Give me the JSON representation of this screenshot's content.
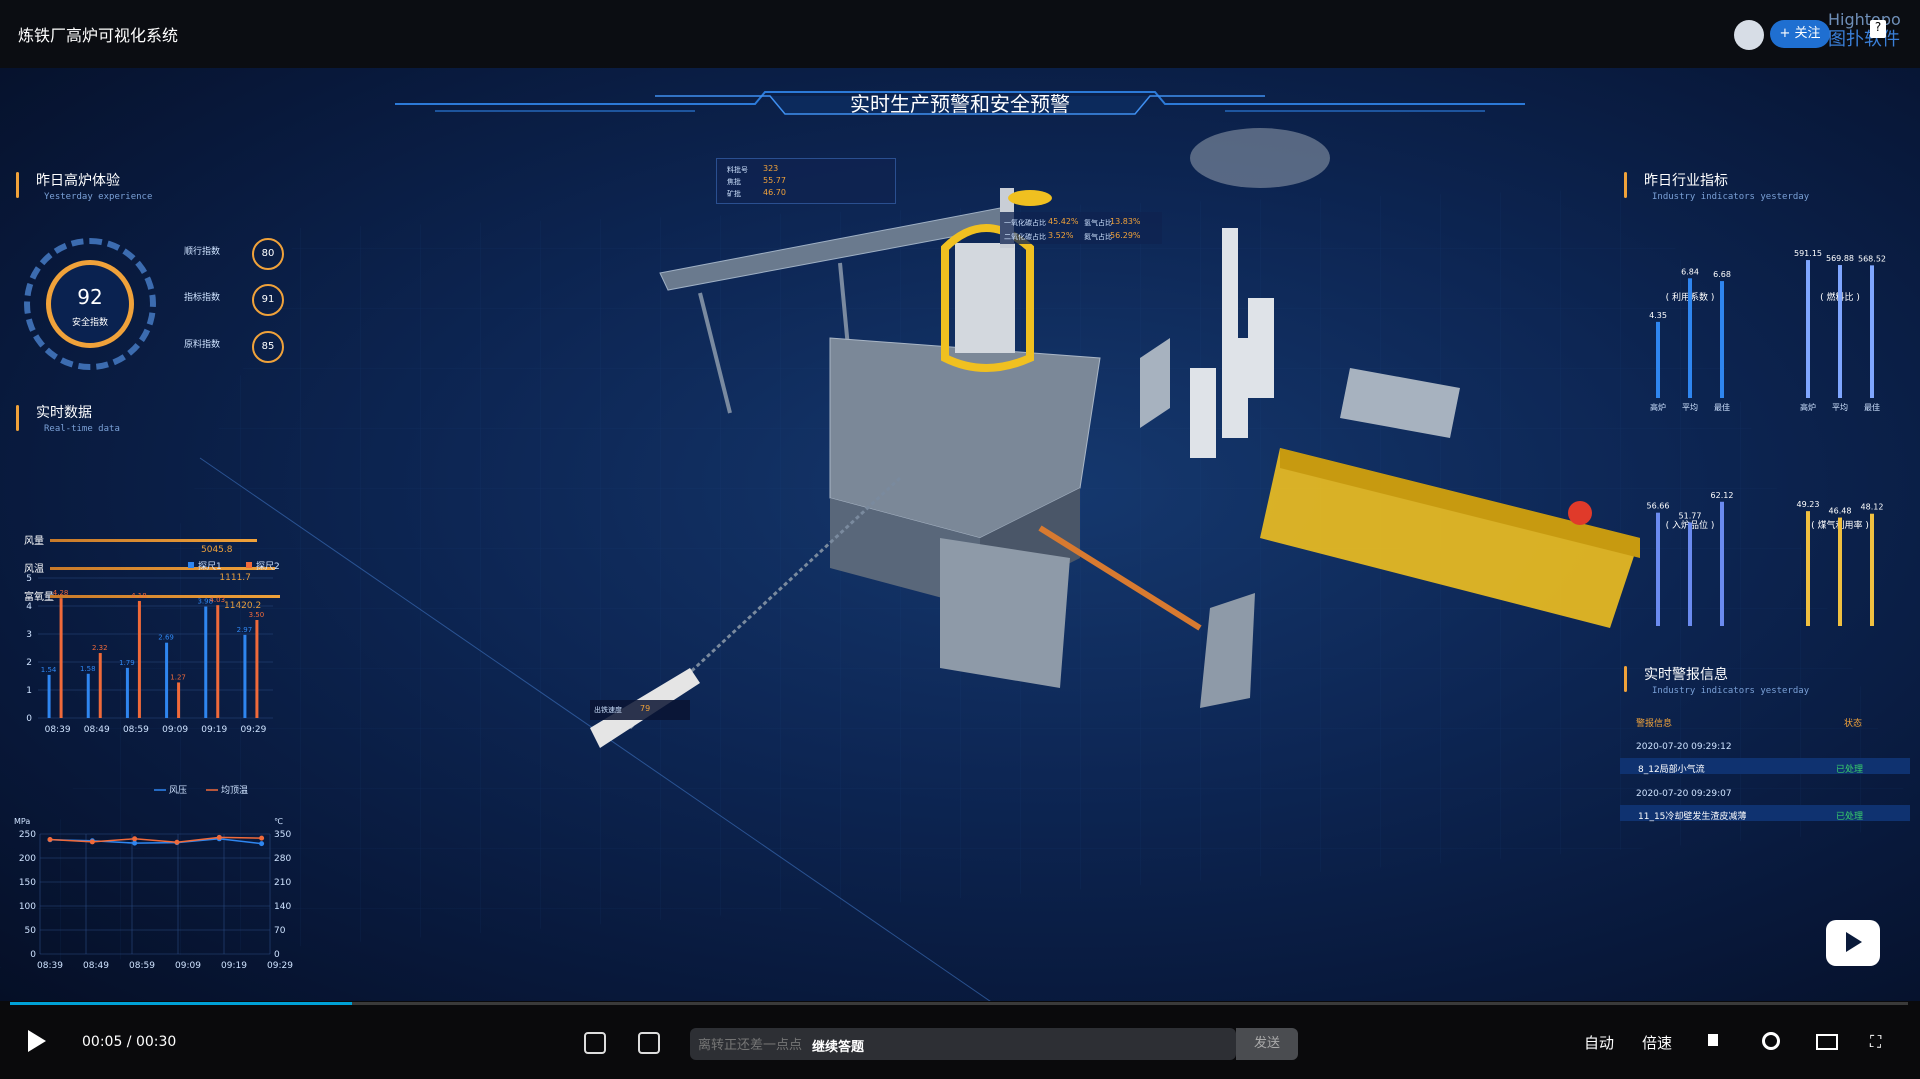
{
  "video": {
    "title": "炼铁厂高炉可视化系统",
    "follow_label": "+ 关注"
  },
  "brand": {
    "name_en": "Hightopo",
    "name_cn": "图扑软件"
  },
  "dashboard": {
    "title": "实时生产预警和安全预警",
    "yesterday_experience": {
      "title": "昨日高炉体验",
      "subtitle": "Yesterday experience",
      "safety_index": 92,
      "safety_label": "安全指数",
      "indices": [
        {
          "label": "顺行指数",
          "value": 80
        },
        {
          "label": "指标指数",
          "value": 91
        },
        {
          "label": "原料指数",
          "value": 85
        }
      ]
    },
    "realtime": {
      "title": "实时数据",
      "subtitle": "Real-time data",
      "bars": [
        {
          "label": "风量",
          "value": "5045.8",
          "fraction": 0.9
        },
        {
          "label": "风温",
          "value": "1111.7",
          "fraction": 0.98
        },
        {
          "label": "富氧量",
          "value": "11420.2",
          "fraction": 1.0
        }
      ]
    },
    "hud": {
      "rows": [
        {
          "k": "料批号",
          "v": "323"
        },
        {
          "k": "焦批",
          "v": "55.77"
        },
        {
          "k": "矿批",
          "v": "46.70"
        }
      ],
      "ratio_rows": [
        {
          "a": "一氧化碳占比",
          "av": "45.42%",
          "b": "氢气占比",
          "bv": "13.83%"
        },
        {
          "a": "二氧化碳占比",
          "av": "3.52%",
          "b": "氮气占比",
          "bv": "56.29%"
        }
      ],
      "speed_label": "出铁速度",
      "speed_value": "79"
    },
    "industry": {
      "title": "昨日行业指标",
      "subtitle": "Industry indicators yesterday"
    },
    "alarms": {
      "title": "实时警报信息",
      "subtitle": "Industry indicators yesterday",
      "col_info": "警报信息",
      "col_state": "状态",
      "items": [
        {
          "time": "2020-07-20 09:29:12",
          "text": "8_12局部小气流",
          "state": "已处理"
        },
        {
          "time": "2020-07-20 09:29:07",
          "text": "11_15冷却壁发生渣皮减薄",
          "state": "已处理"
        }
      ]
    }
  },
  "chart_data": [
    {
      "type": "bar",
      "categories": [
        "08:39",
        "08:49",
        "08:59",
        "09:09",
        "09:19",
        "09:29"
      ],
      "series": [
        {
          "name": "探尺1",
          "values": [
            1.54,
            1.58,
            1.79,
            2.69,
            3.98,
            2.97
          ],
          "color": "#2f86f0"
        },
        {
          "name": "探尺2",
          "values": [
            4.28,
            2.32,
            4.18,
            1.27,
            4.03,
            3.5
          ],
          "color": "#f06a3a"
        }
      ],
      "ylim": [
        0,
        5
      ],
      "yticks": [
        0,
        1,
        2,
        3,
        4,
        5
      ]
    },
    {
      "type": "line",
      "categories": [
        "08:39",
        "08:49",
        "08:59",
        "09:09",
        "09:19",
        "09:29"
      ],
      "ylabel": "MPa",
      "y2label": "℃",
      "yticks": [
        0,
        50,
        100,
        150,
        200,
        250
      ],
      "y2ticks": [
        0,
        70,
        140,
        210,
        280,
        350
      ],
      "series": [
        {
          "name": "风压",
          "axis": "left",
          "values": [
            238,
            236,
            231,
            232,
            240,
            230
          ],
          "color": "#2f86f0"
        },
        {
          "name": "均顶温",
          "axis": "right",
          "values": [
            334,
            327,
            336,
            326,
            340,
            338
          ],
          "color": "#f06a3a"
        }
      ]
    },
    {
      "type": "bar",
      "title": "利用系数",
      "categories": [
        "高炉",
        "平均",
        "最佳"
      ],
      "values": [
        4.35,
        6.84,
        6.68
      ],
      "labels": [
        "4.35",
        "6.84",
        "6.68"
      ],
      "ylim": [
        0,
        8
      ],
      "color": "#2f86f0"
    },
    {
      "type": "bar",
      "title": "燃料比",
      "categories": [
        "高炉",
        "平均",
        "最佳"
      ],
      "values": [
        591.15,
        569.88,
        568.52
      ],
      "labels": [
        "591.15",
        "569.88",
        "568.52"
      ],
      "ylim": [
        0,
        600
      ],
      "color": "#7fa6ff"
    },
    {
      "type": "bar",
      "title": "入炉品位",
      "categories": [
        "高炉",
        "平均",
        "最佳"
      ],
      "values": [
        56.66,
        51.77,
        62.12
      ],
      "labels": [
        "56.66",
        "51.77",
        "62.12"
      ],
      "ylim": [
        0,
        70
      ],
      "color": "#6b8bf0"
    },
    {
      "type": "bar",
      "title": "煤气利用率",
      "categories": [
        "高炉",
        "平均",
        "最佳"
      ],
      "values": [
        49.23,
        46.48,
        48.12
      ],
      "labels": [
        "49.23",
        "46.48",
        "48.12"
      ],
      "ylim": [
        0,
        60
      ],
      "color": "#f0c040"
    }
  ],
  "player": {
    "time_current": "00:05",
    "time_total": "00:30",
    "progress": 0.18,
    "danmaku_placeholder": "离转正还差一点点",
    "danmaku_cta": "继续答题",
    "send_label": "发送",
    "auto_label": "自动",
    "speed_label": "倍速"
  }
}
